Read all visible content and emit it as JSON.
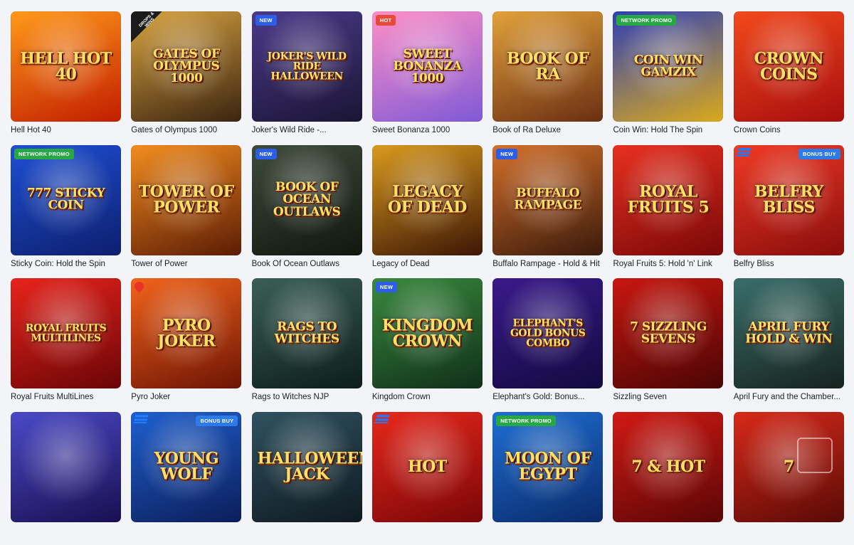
{
  "games": [
    {
      "title": "Hell Hot 40",
      "art": "HELL HOT 40",
      "bg": [
        "#ff9a1a",
        "#c21d00"
      ],
      "badge": null
    },
    {
      "title": "Gates of Olympus 1000",
      "art": "Gates of OLYMPUS 1000",
      "bg": [
        "#d9a441",
        "#3b2410"
      ],
      "badge": null,
      "corner": "DROPS & WINS"
    },
    {
      "title": "Joker's Wild Ride -...",
      "art": "JOKER'S WILD RIDE HALLOWEEN",
      "bg": [
        "#4b3a8a",
        "#1a1535"
      ],
      "badge": {
        "text": "NEW",
        "type": "new"
      }
    },
    {
      "title": "Sweet Bonanza 1000",
      "art": "SWEET BONANZA 1000",
      "bg": [
        "#ff8fc6",
        "#7f5ad6"
      ],
      "badge": {
        "text": "HOT",
        "type": "hot"
      }
    },
    {
      "title": "Book of Ra Deluxe",
      "art": "BOOK OF RA",
      "bg": [
        "#e2a13b",
        "#6b2f12"
      ],
      "badge": null
    },
    {
      "title": "Coin Win: Hold The Spin",
      "art": "COIN WIN GAMZIX",
      "bg": [
        "#2e3fb8",
        "#d9a91c"
      ],
      "badge": {
        "text": "NETWORK PROMO",
        "type": "promo"
      }
    },
    {
      "title": "Crown Coins",
      "art": "CROWN COINS",
      "bg": [
        "#f24a1d",
        "#a80e0e"
      ],
      "badge": null
    },
    {
      "title": "Sticky Coin: Hold the Spin",
      "art": "777 STICKY COIN",
      "bg": [
        "#1e4fd4",
        "#0d1f6e"
      ],
      "badge": {
        "text": "NETWORK PROMO",
        "type": "promo"
      }
    },
    {
      "title": "Tower of Power",
      "art": "TOWER of POWER",
      "bg": [
        "#f28c1e",
        "#5c1c05"
      ],
      "badge": null
    },
    {
      "title": "Book Of Ocean Outlaws",
      "art": "BOOK OF OCEAN OUTLAWS",
      "bg": [
        "#3e4b3b",
        "#10170f"
      ],
      "badge": {
        "text": "NEW",
        "type": "new"
      }
    },
    {
      "title": "Legacy of Dead",
      "art": "LEGACY OF DEAD",
      "bg": [
        "#d99a1e",
        "#3d1605"
      ],
      "badge": null
    },
    {
      "title": "Buffalo Rampage - Hold & Hit",
      "art": "BUFFALO RAMPAGE",
      "bg": [
        "#d4702a",
        "#3a1a0c"
      ],
      "badge": {
        "text": "NEW",
        "type": "new"
      }
    },
    {
      "title": "Royal Fruits 5: Hold 'n' Link",
      "art": "ROYAL FRUITS 5",
      "bg": [
        "#e83020",
        "#7a0808"
      ],
      "badge": null
    },
    {
      "title": "Belfry Bliss",
      "art": "BELFRY BLISS",
      "bg": [
        "#f03a24",
        "#8a0d0d"
      ],
      "badge": {
        "text": "BONUS BUY",
        "type": "bonus"
      },
      "provider": true
    },
    {
      "title": "Royal Fruits MultiLines",
      "art": "ROYAL FRUITS MULTILINES",
      "bg": [
        "#e8241c",
        "#6b0507"
      ],
      "badge": null
    },
    {
      "title": "Pyro Joker",
      "art": "PYRO JOKER",
      "bg": [
        "#f2641a",
        "#6e1405"
      ],
      "badge": null,
      "flame": true
    },
    {
      "title": "Rags to Witches NJP",
      "art": "RAGS TO WITCHES",
      "bg": [
        "#3a5f55",
        "#0d1d1c"
      ],
      "badge": null
    },
    {
      "title": "Kingdom Crown",
      "art": "KINGDOM CROWN",
      "bg": [
        "#3a8a3e",
        "#10301a"
      ],
      "badge": {
        "text": "NEW",
        "type": "new"
      }
    },
    {
      "title": "Elephant's Gold: Bonus...",
      "art": "ELEPHANT'S GOLD BONUS COMBO",
      "bg": [
        "#3a1a8a",
        "#120a40"
      ],
      "badge": null
    },
    {
      "title": "Sizzling Seven",
      "art": "7 SIZZLING SEVENS",
      "bg": [
        "#c9170f",
        "#4a0505"
      ],
      "badge": null
    },
    {
      "title": "April Fury and the Chamber...",
      "art": "APRIL FURY HOLD & WIN",
      "bg": [
        "#3a6e6a",
        "#17231f"
      ],
      "badge": null
    },
    {
      "title": "",
      "art": "",
      "bg": [
        "#4a4ac8",
        "#1a0f50"
      ],
      "badge": null
    },
    {
      "title": "",
      "art": "YOUNG WOLF",
      "bg": [
        "#1f5fcf",
        "#0c1e5a"
      ],
      "badge": {
        "text": "BONUS BUY",
        "type": "bonus"
      },
      "provider": true
    },
    {
      "title": "",
      "art": "HALLOWEEN JACK",
      "bg": [
        "#2f5260",
        "#0f1a20"
      ],
      "badge": null
    },
    {
      "title": "",
      "art": "HOT",
      "bg": [
        "#e8281c",
        "#7a0608"
      ],
      "badge": null,
      "provider": true
    },
    {
      "title": "",
      "art": "MOON OF EGYPT",
      "bg": [
        "#1f6fd4",
        "#0a2a6a"
      ],
      "badge": {
        "text": "NETWORK PROMO",
        "type": "promo"
      }
    },
    {
      "title": "",
      "art": "7 & HOT",
      "bg": [
        "#d21a14",
        "#5a0606"
      ],
      "badge": null
    },
    {
      "title": "",
      "art": "7",
      "bg": [
        "#d82a1a",
        "#5a0a06"
      ],
      "badge": null
    }
  ]
}
